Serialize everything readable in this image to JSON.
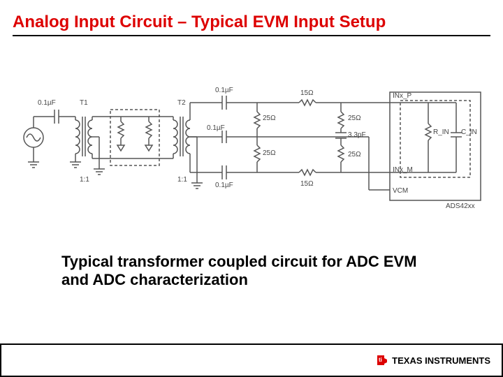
{
  "title": "Analog Input Circuit – Typical EVM Input Setup",
  "caption": "Typical transformer coupled circuit for ADC EVM and ADC characterization",
  "logo_text": "TEXAS INSTRUMENTS",
  "schematic": {
    "c_in_src": "0.1µF",
    "t1": "T1",
    "t1_ratio": "1:1",
    "t2": "T2",
    "t2_ratio": "1:1",
    "c_top1": "0.1µF",
    "c_mid": "0.1µF",
    "c_bot1": "0.1µF",
    "r25a": "25Ω",
    "r25b": "25Ω",
    "r15a": "15Ω",
    "r15b": "15Ω",
    "r25c": "25Ω",
    "r25d": "25Ω",
    "c_3p3": "3.3pF",
    "inx_p": "INx_P",
    "inx_m": "INx_M",
    "rin": "R_IN",
    "cin": "C_IN",
    "vcm": "VCM",
    "part": "ADS42xx"
  }
}
